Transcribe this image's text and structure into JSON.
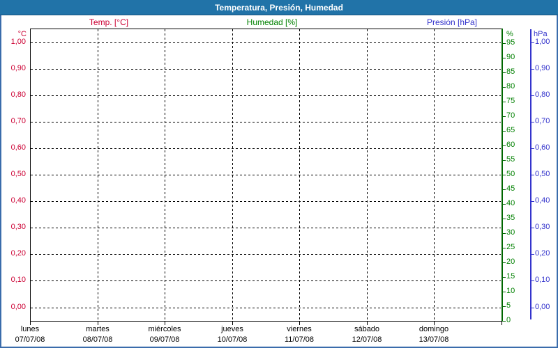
{
  "window": {
    "title": "Temperatura, Presión, Humedad"
  },
  "legend": {
    "temp": "Temp. [°C]",
    "humidity": "Humedad [%]",
    "pressure": "Presión [hPa]"
  },
  "chart_data": {
    "type": "line",
    "title": "Temperatura, Presión, Humedad",
    "grid": true,
    "legend_position": "top",
    "x_axis": {
      "days": [
        {
          "name": "lunes",
          "date": "07/07/08"
        },
        {
          "name": "martes",
          "date": "08/07/08"
        },
        {
          "name": "miércoles",
          "date": "09/07/08"
        },
        {
          "name": "jueves",
          "date": "10/07/08"
        },
        {
          "name": "viernes",
          "date": "11/07/08"
        },
        {
          "name": "sábado",
          "date": "12/07/08"
        },
        {
          "name": "domingo",
          "date": "13/07/08"
        }
      ]
    },
    "axes": {
      "temp": {
        "unit": "°C",
        "side": "left",
        "color": "#cc0033",
        "min": 0,
        "max": 1,
        "tick_labels": [
          "1,00",
          "0,90",
          "0,80",
          "0,70",
          "0,60",
          "0,50",
          "0,40",
          "0,30",
          "0,20",
          "0,10",
          "0,00"
        ]
      },
      "humidity": {
        "unit": "%",
        "side": "right-inner",
        "color": "#008000",
        "min": 0,
        "max": 100,
        "tick_labels": [
          "95",
          "90",
          "85",
          "80",
          "75",
          "70",
          "65",
          "60",
          "55",
          "50",
          "45",
          "40",
          "35",
          "30",
          "25",
          "20",
          "15",
          "10",
          "5",
          "0"
        ]
      },
      "pressure": {
        "unit": "hPa",
        "side": "right-outer",
        "color": "#3333cc",
        "min": 0,
        "max": 1,
        "tick_labels": [
          "1,00",
          "0,90",
          "0,80",
          "0,70",
          "0,60",
          "0,50",
          "0,40",
          "0,30",
          "0,20",
          "0,10",
          "0,00"
        ]
      }
    },
    "series": [
      {
        "name": "Temp. [°C]",
        "axis": "temp",
        "color": "#cc0033",
        "values": []
      },
      {
        "name": "Humedad [%]",
        "axis": "humidity",
        "color": "#008000",
        "values": []
      },
      {
        "name": "Presión [hPa]",
        "axis": "pressure",
        "color": "#3333cc",
        "values": []
      }
    ]
  },
  "colors": {
    "titlebar_bg": "#2173a8",
    "titlebar_edge": "#15527e",
    "window_border": "#3a6cab",
    "temp": "#cc0033",
    "humidity_text": "#008000",
    "humidity_axis": "#006600",
    "pressure": "#3333cc",
    "grid": "#000000"
  }
}
